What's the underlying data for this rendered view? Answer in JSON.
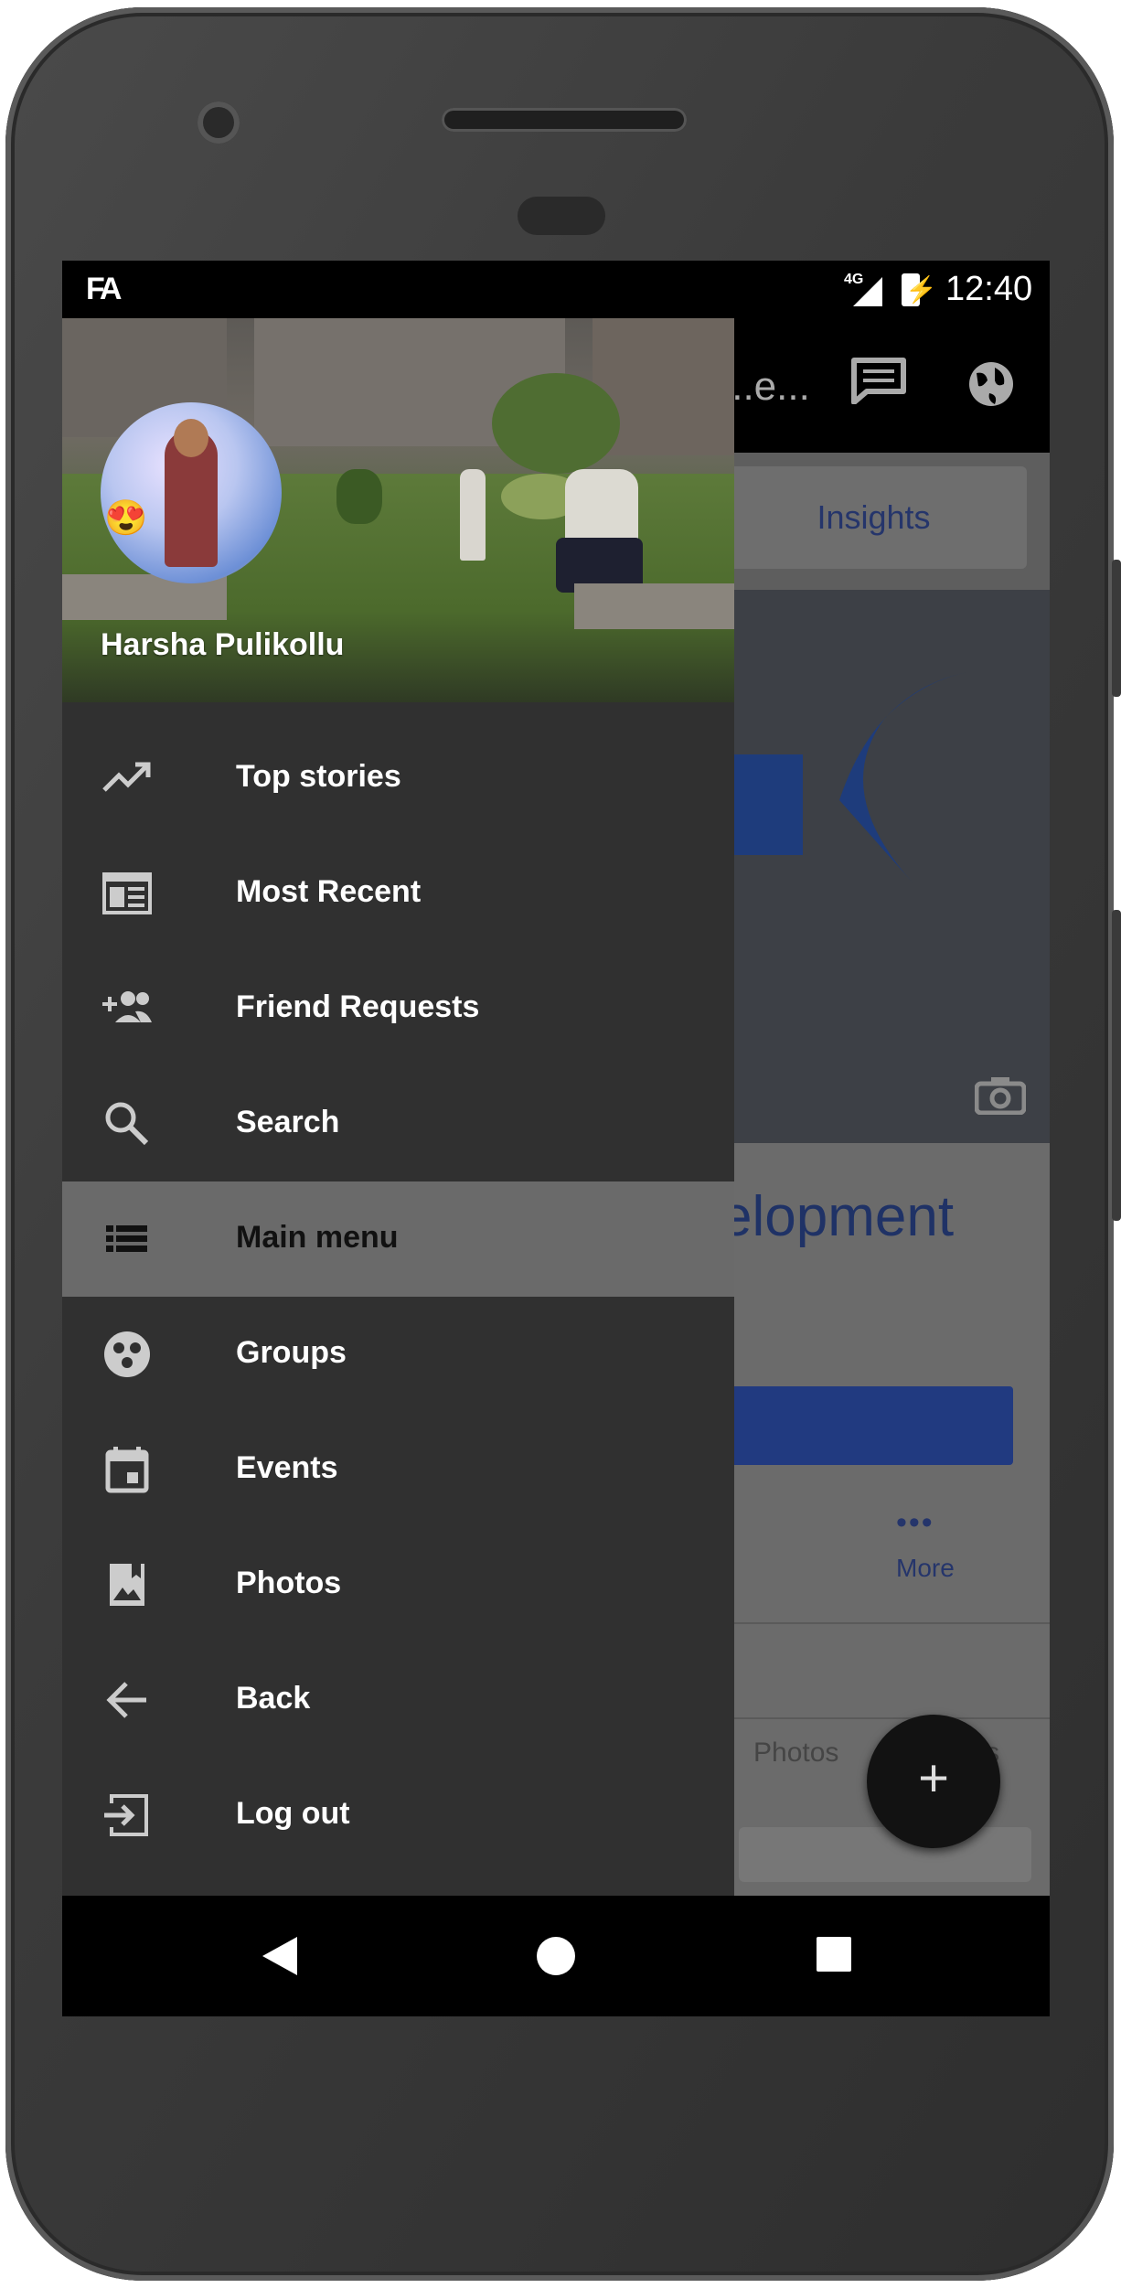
{
  "status_bar": {
    "app_icon": "FA",
    "network": "4G",
    "time": "12:40"
  },
  "background_app": {
    "toolbar_title": "...e...",
    "tab_insights": "Insights",
    "page_name_fragment": "elopment",
    "more_label": "More",
    "more_dots": "•••",
    "tab_photos": "Photos",
    "tab_photos_suffix": "s",
    "fab_label": "+",
    "icons": [
      "chat-icon",
      "globe-icon",
      "camera-icon"
    ]
  },
  "drawer": {
    "profile_name": "Harsha Pulikollu",
    "items": [
      {
        "label": "Top stories",
        "icon": "trending-up-icon"
      },
      {
        "label": "Most Recent",
        "icon": "newspaper-icon"
      },
      {
        "label": "Friend Requests",
        "icon": "add-friend-icon"
      },
      {
        "label": "Search",
        "icon": "search-icon"
      },
      {
        "label": "Main menu",
        "icon": "list-icon",
        "active": true
      },
      {
        "label": "Groups",
        "icon": "groups-icon"
      },
      {
        "label": "Events",
        "icon": "calendar-icon"
      },
      {
        "label": "Photos",
        "icon": "photo-icon"
      },
      {
        "label": "Back",
        "icon": "arrow-left-icon"
      },
      {
        "label": "Log out",
        "icon": "logout-icon"
      }
    ]
  },
  "nav_bar": {
    "buttons": [
      "back-button",
      "home-button",
      "recents-button"
    ]
  },
  "colors": {
    "drawer_bg": "#303030",
    "active_item_bg": "#6a6a6a",
    "accent_blue": "#213a80"
  }
}
